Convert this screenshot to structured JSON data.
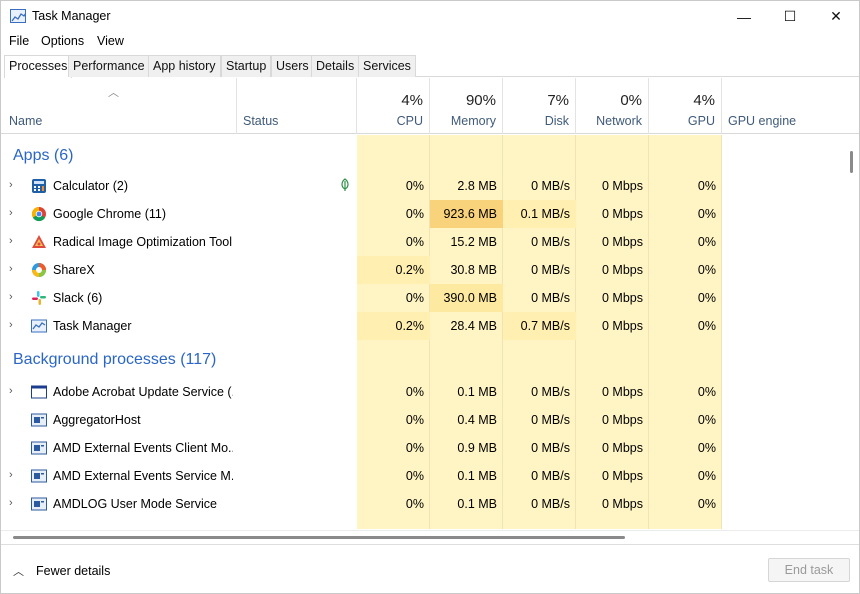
{
  "window": {
    "title": "Task Manager",
    "controls": {
      "minimize": "—",
      "maximize": "☐",
      "close": "✕"
    }
  },
  "menu": [
    "File",
    "Options",
    "View"
  ],
  "tabs": [
    "Processes",
    "Performance",
    "App history",
    "Startup",
    "Users",
    "Details",
    "Services"
  ],
  "active_tab": "Processes",
  "columns": {
    "name": "Name",
    "status": "Status",
    "cpu": {
      "label": "CPU",
      "pct": "4%"
    },
    "memory": {
      "label": "Memory",
      "pct": "90%"
    },
    "disk": {
      "label": "Disk",
      "pct": "7%"
    },
    "network": {
      "label": "Network",
      "pct": "0%"
    },
    "gpu": {
      "label": "GPU",
      "pct": "4%"
    },
    "gpu_engine": "GPU engine"
  },
  "groups": {
    "apps": "Apps (6)",
    "background": "Background processes (117)"
  },
  "apps": [
    {
      "name": "Calculator (2)",
      "icon": "calculator-icon",
      "cpu": "0%",
      "memory": "2.8 MB",
      "disk": "0 MB/s",
      "network": "0 Mbps",
      "gpu": "0%",
      "expandable": true,
      "status_icon": "leaf-icon"
    },
    {
      "name": "Google Chrome (11)",
      "icon": "chrome-icon",
      "cpu": "0%",
      "memory": "923.6 MB",
      "disk": "0.1 MB/s",
      "network": "0 Mbps",
      "gpu": "0%",
      "expandable": true
    },
    {
      "name": "Radical Image Optimization Tool",
      "icon": "riot-icon",
      "cpu": "0%",
      "memory": "15.2 MB",
      "disk": "0 MB/s",
      "network": "0 Mbps",
      "gpu": "0%",
      "expandable": true
    },
    {
      "name": "ShareX",
      "icon": "sharex-icon",
      "cpu": "0.2%",
      "memory": "30.8 MB",
      "disk": "0 MB/s",
      "network": "0 Mbps",
      "gpu": "0%",
      "expandable": true
    },
    {
      "name": "Slack (6)",
      "icon": "slack-icon",
      "cpu": "0%",
      "memory": "390.0 MB",
      "disk": "0 MB/s",
      "network": "0 Mbps",
      "gpu": "0%",
      "expandable": true
    },
    {
      "name": "Task Manager",
      "icon": "task-manager-icon",
      "cpu": "0.2%",
      "memory": "28.4 MB",
      "disk": "0.7 MB/s",
      "network": "0 Mbps",
      "gpu": "0%",
      "expandable": true
    }
  ],
  "background": [
    {
      "name": "Adobe Acrobat Update Service (...",
      "icon": "window-icon",
      "cpu": "0%",
      "memory": "0.1 MB",
      "disk": "0 MB/s",
      "network": "0 Mbps",
      "gpu": "0%",
      "expandable": true
    },
    {
      "name": "AggregatorHost",
      "icon": "service-icon",
      "cpu": "0%",
      "memory": "0.4 MB",
      "disk": "0 MB/s",
      "network": "0 Mbps",
      "gpu": "0%",
      "expandable": false
    },
    {
      "name": "AMD External Events Client Mo...",
      "icon": "service-icon",
      "cpu": "0%",
      "memory": "0.9 MB",
      "disk": "0 MB/s",
      "network": "0 Mbps",
      "gpu": "0%",
      "expandable": false
    },
    {
      "name": "AMD External Events Service M...",
      "icon": "service-icon",
      "cpu": "0%",
      "memory": "0.1 MB",
      "disk": "0 MB/s",
      "network": "0 Mbps",
      "gpu": "0%",
      "expandable": true
    },
    {
      "name": "AMDLOG User Mode Service",
      "icon": "service-icon",
      "cpu": "0%",
      "memory": "0.1 MB",
      "disk": "0 MB/s",
      "network": "0 Mbps",
      "gpu": "0%",
      "expandable": true
    }
  ],
  "heat_colors": {
    "base": "#fff4c4",
    "light": "#ffefb0",
    "medium": "#fde9a0",
    "high": "#f9d27c"
  },
  "footer": {
    "fewer_details": "Fewer details",
    "end_task": "End task"
  }
}
